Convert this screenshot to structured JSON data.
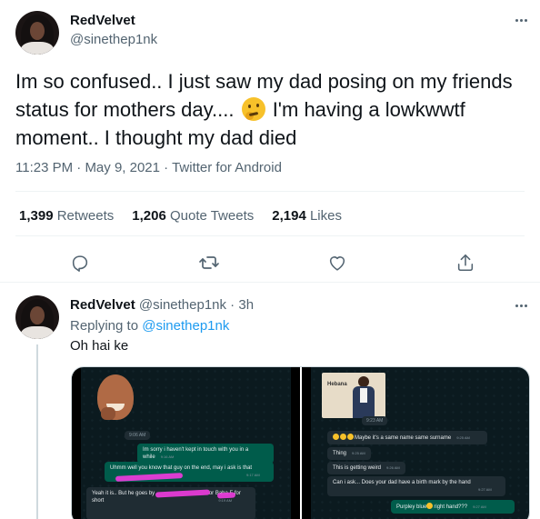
{
  "main_tweet": {
    "author": {
      "display_name": "RedVelvet",
      "handle": "@sinethep1nk"
    },
    "text_before_emoji": "Im so confused.. I just saw my dad posing on my friends status for mothers day.... ",
    "text_after_emoji": " I'm having a lowkwwtf moment.. I thought my dad died",
    "emoji_icon": "thinking-face-emoji",
    "time": "11:23 PM",
    "date": "May 9, 2021",
    "source": "Twitter for Android",
    "stats": {
      "retweets_count": "1,399",
      "retweets_label": "Retweets",
      "quotes_count": "1,206",
      "quotes_label": "Quote Tweets",
      "likes_count": "2,194",
      "likes_label": "Likes"
    },
    "actions": [
      "reply-icon",
      "retweet-icon",
      "like-icon",
      "share-icon"
    ]
  },
  "reply_tweet": {
    "author": {
      "display_name": "RedVelvet",
      "handle": "@sinethep1nk",
      "age": "3h"
    },
    "replying_prefix": "Replying to",
    "replying_to": "@sinethep1nk",
    "text": "Oh hai ke",
    "media": {
      "left_shot": {
        "messages": [
          {
            "side": "day",
            "text": "9:06 AM"
          },
          {
            "side": "out",
            "text": "Im sorry i haven't kept in touch with you in a while",
            "time": "9:16 AM"
          },
          {
            "side": "out",
            "text": "Uhmm well you know that guy on the end, may i ask is that",
            "time": "9:17 AM"
          },
          {
            "side": "in",
            "text": "Yeah it is.. But he goes by",
            "text2": "or Baba F",
            "text3": "for",
            "text4": "short",
            "time": "9:19 AM"
          }
        ]
      },
      "right_shot": {
        "photo_label": "Hebana",
        "messages": [
          {
            "side": "time",
            "text": "9:23 AM"
          },
          {
            "side": "in",
            "text": "Maybe it's a same name same surname",
            "time": "9:25 AM"
          },
          {
            "side": "in",
            "text": "Thing",
            "time": "9:25 AM"
          },
          {
            "side": "in",
            "text": "This is getting weird",
            "time": "9:26 AM"
          },
          {
            "side": "in",
            "text": "Can i ask... Does your dad have a birth mark by the hand",
            "time": "9:27 AM"
          },
          {
            "side": "out",
            "text": "Purpley blue",
            "text2": "right hand???",
            "time": "9:27 AM"
          }
        ]
      }
    }
  },
  "colors": {
    "accent": "#1d9bf0",
    "muted": "#536471",
    "text": "#0f1419",
    "whatsapp_out": "#005c4b",
    "whatsapp_in": "#1f2c33"
  }
}
